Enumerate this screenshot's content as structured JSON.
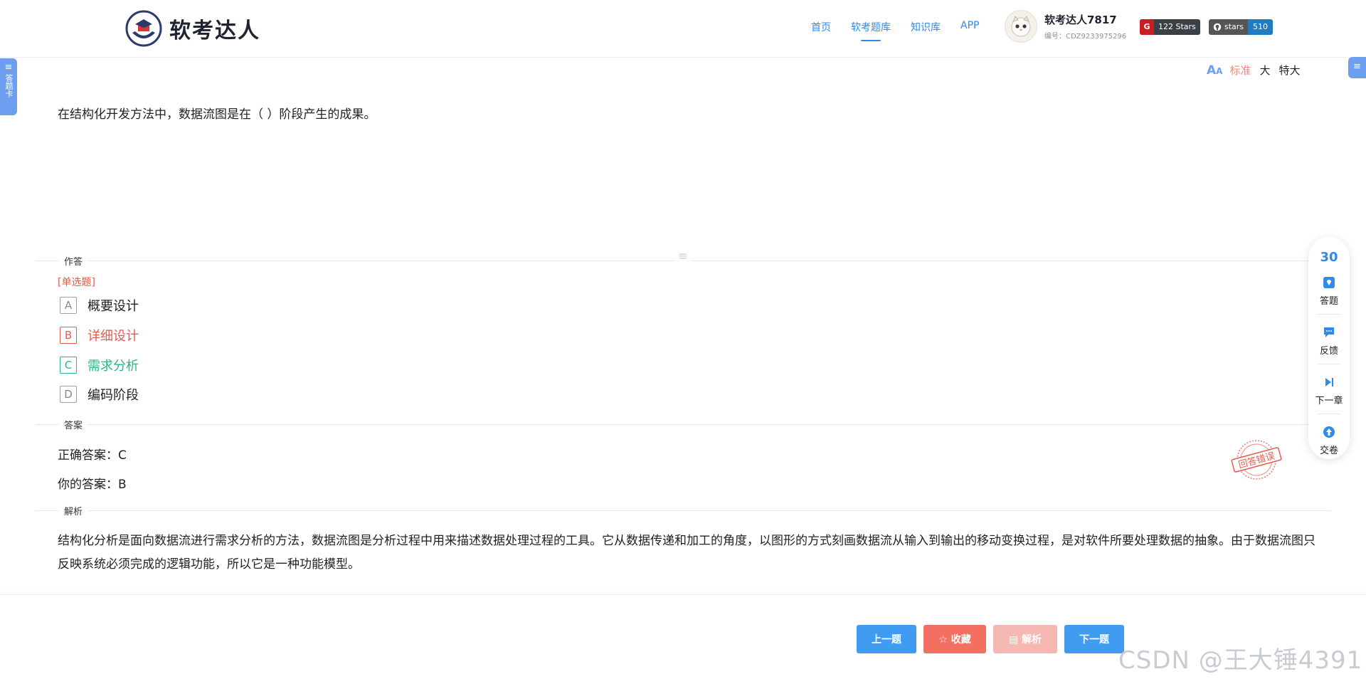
{
  "header": {
    "logo_text": "软考达人",
    "nav": [
      {
        "label": "首页",
        "active": false
      },
      {
        "label": "软考题库",
        "active": true
      },
      {
        "label": "知识库",
        "active": false
      },
      {
        "label": "APP",
        "active": false
      }
    ],
    "user": {
      "name": "软考达人7817",
      "id": "编号：CDZ9233975296"
    },
    "gitee_badge": "122 Stars",
    "github_badge": {
      "left": "stars",
      "right": "510"
    }
  },
  "side": {
    "left_tab": "答题卡"
  },
  "font_selector": {
    "options": [
      "标准",
      "大",
      "特大"
    ],
    "selected": "标准"
  },
  "question": {
    "text": "在结构化开发方法中，数据流图是在（ ）阶段产生的成果。",
    "type_label": "[单选题]"
  },
  "sections": {
    "answer_area": "作答",
    "answer": "答案",
    "analysis": "解析"
  },
  "options": [
    {
      "letter": "A",
      "text": "概要设计",
      "state": "normal"
    },
    {
      "letter": "B",
      "text": "详细设计",
      "state": "wrong"
    },
    {
      "letter": "C",
      "text": "需求分析",
      "state": "right"
    },
    {
      "letter": "D",
      "text": "编码阶段",
      "state": "normal"
    }
  ],
  "answer": {
    "correct": "正确答案：C",
    "yours": "你的答案：B",
    "stamp": "回答错误"
  },
  "analysis": {
    "text": "结构化分析是面向数据流进行需求分析的方法，数据流图是分析过程中用来描述数据处理过程的工具。它从数据传递和加工的角度，以图形的方式刻画数据流从输入到输出的移动变换过程，是对软件所要处理数据的抽象。由于数据流图只反映系统必须完成的逻辑功能，所以它是一种功能模型。"
  },
  "float_panel": {
    "count": "30",
    "items": [
      {
        "label": "答题",
        "icon": "answer-sheet-icon"
      },
      {
        "label": "反馈",
        "icon": "feedback-icon"
      },
      {
        "label": "下一章",
        "icon": "next-chapter-icon"
      },
      {
        "label": "交卷",
        "icon": "submit-icon"
      }
    ]
  },
  "buttons": {
    "prev": "上一题",
    "favorite": "☆ 收藏",
    "analysis": "▤ 解析",
    "next": "下一题"
  },
  "watermark": "CSDN @王大锤4391",
  "colors": {
    "accent": "#2f8ae8",
    "wrong": "#e35b4e",
    "right": "#2cb48a",
    "favorite": "#f36f62"
  }
}
